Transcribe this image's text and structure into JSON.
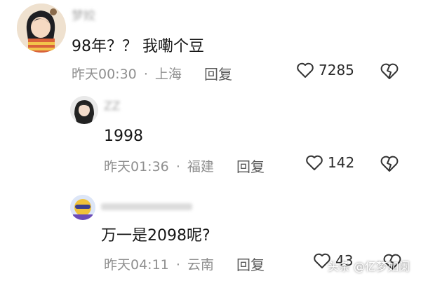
{
  "comments": [
    {
      "username": "梦姣",
      "content": "98年？？ 我嘞个豆",
      "time": "昨天00:30",
      "separator": "·",
      "location": "上海",
      "reply_label": "回复",
      "likes": "7285"
    },
    {
      "username": "ZZ",
      "content": "1998",
      "time": "昨天01:36",
      "separator": "·",
      "location": "福建",
      "reply_label": "回复",
      "likes": "142"
    },
    {
      "username": "",
      "content": "万一是2098呢?",
      "time": "昨天04:11",
      "separator": "·",
      "location": "云南",
      "reply_label": "回复",
      "likes": "43"
    }
  ],
  "watermark": "头条 @亿梦如阑",
  "colors": {
    "meta": "#8f8f8f",
    "username": "#a6a6a6",
    "content": "#161616"
  }
}
